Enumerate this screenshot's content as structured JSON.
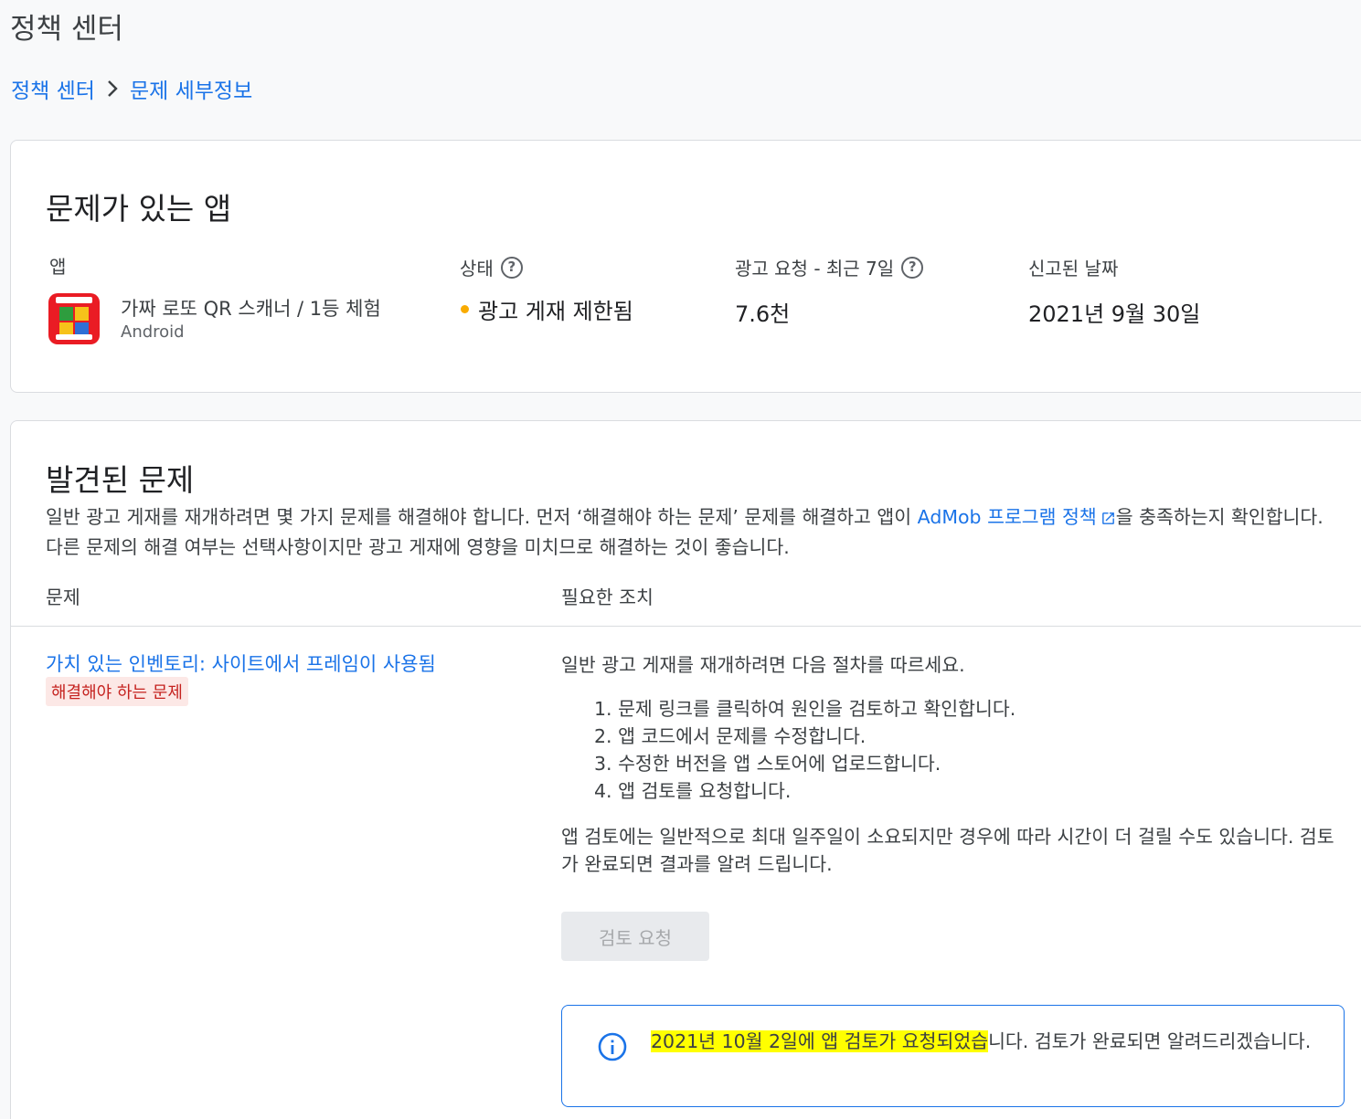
{
  "page": {
    "title": "정책 센터"
  },
  "breadcrumb": {
    "root": "정책 센터",
    "current": "문제 세부정보"
  },
  "apps_card": {
    "title": "문제가 있는 앱",
    "columns": {
      "app": "앱",
      "status": "상태",
      "ad_requests": "광고 요청 - 최근 7일",
      "reported_date": "신고된 날짜"
    },
    "app": {
      "name": "가짜 로또 QR 스캐너 / 1등 체험",
      "platform": "Android",
      "icon": "app-icon"
    },
    "status": {
      "label": "광고 게재 제한됨",
      "color": "#f9ab00"
    },
    "ad_requests": "7.6천",
    "reported_date": "2021년 9월 30일"
  },
  "issues_card": {
    "title": "발견된 문제",
    "description_before": "일반 광고 게재를 재개하려면 몇 가지 문제를 해결해야 합니다. 먼저 ‘해결해야 하는 문제’ 문제를 해결하고 앱이 ",
    "description_link": "AdMob 프로그램 정책",
    "description_after": "을 충족하는지 확인합니다. 다른 문제의 해결 여부는 선택사항이지만 광고 게재에 영향을 미치므로 해결하는 것이 좋습니다.",
    "headers": {
      "issue": "문제",
      "action": "필요한 조치"
    },
    "issue": {
      "title": "가치 있는 인벤토리: 사이트에서 프레임이 사용됨",
      "badge": "해결해야 하는 문제"
    },
    "action": {
      "intro": "일반 광고 게재를 재개하려면 다음 절차를 따르세요.",
      "steps": [
        "1. 문제 링크를 클릭하여 원인을 검토하고 확인합니다.",
        "2. 앱 코드에서 문제를 수정합니다.",
        "3. 수정한 버전을 앱 스토어에 업로드합니다.",
        "4. 앱 검토를 요청합니다."
      ],
      "note": "앱 검토에는 일반적으로 최대 일주일이 소요되지만 경우에 따라 시간이 더 걸릴 수도 있습니다. 검토가 완료되면 결과를 알려 드립니다.",
      "button": "검토 요청"
    },
    "info": {
      "highlighted": "2021년 10월 2일에 앱 검토가 요청되었습",
      "rest": "니다. 검토가 완료되면 알려드리겠습니다."
    }
  },
  "colors": {
    "accent": "#1a73e8",
    "highlight": "#ffff00",
    "badge_bg": "#fce8e6",
    "badge_text": "#c5221f"
  }
}
